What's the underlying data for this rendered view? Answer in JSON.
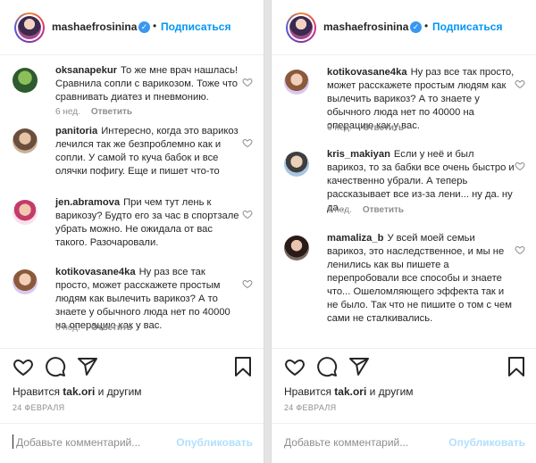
{
  "post": {
    "username": "mashaefrosinina",
    "follow_label": "Подписаться",
    "dot": "•",
    "likes_prefix": "Нравится ",
    "likes_user": "tak.ori",
    "likes_suffix": " и другим",
    "date": "24 ФЕВРАЛЯ",
    "add_comment_placeholder": "Добавьте комментарий...",
    "publish_label": "Опубликовать",
    "reply_label": "Ответить",
    "time_label": "6 нед."
  },
  "left_comments": [
    {
      "user": "oksanapekur",
      "text": "То же мне врач нашлась! Сравнила сопли с варикозом. Тоже что сравнивать диатез и пневмонию."
    },
    {
      "user": "panitoria",
      "text": "Интересно, когда это варикоз лечился так же безпроблемно как и сопли. У самой то куча бабок и все олячки пофигу. Еще и пишет что-то"
    },
    {
      "user": "jen.abramova",
      "text": "При чем тут лень к варикозу? Будто его за час в спортзале убрать можно. Не ожидала от вас такого. Разочаровали."
    },
    {
      "user": "kotikovasane4ka",
      "text": "Ну раз все так просто, может расскажете простым людям как вылечить варикоз? А то знаете у обычного люда нет по 40000 на операцию как у вас."
    }
  ],
  "right_comments": [
    {
      "user": "kotikovasane4ka",
      "text": "Ну раз все так просто, может расскажете простым людям как вылечить варикоз? А то знаете у обычного люда нет по 40000 на операцию как у вас."
    },
    {
      "user": "kris_makiyan",
      "text": "Если у неё и был варикоз, то за бабки все очень быстро и качественно убрали. А теперь рассказывает все из-за лени... ну да. ну да..."
    },
    {
      "user": "mamaliza_b",
      "text": "У всей моей семьи варикоз, это наследственное, и мы не ленились как вы пишете а перепробовали все способы и знаете что... Ошеломляющего эффекта так и не было. Так что не пишите о том с чем сами не сталкивались."
    }
  ],
  "colors": {
    "link_blue": "#0095f6",
    "publish_disabled": "#b2dffc",
    "meta_gray": "#8e8e8e",
    "text_dark": "#262626"
  },
  "icons": [
    "heart-icon",
    "comment-icon",
    "share-icon",
    "bookmark-icon",
    "verified-icon"
  ]
}
